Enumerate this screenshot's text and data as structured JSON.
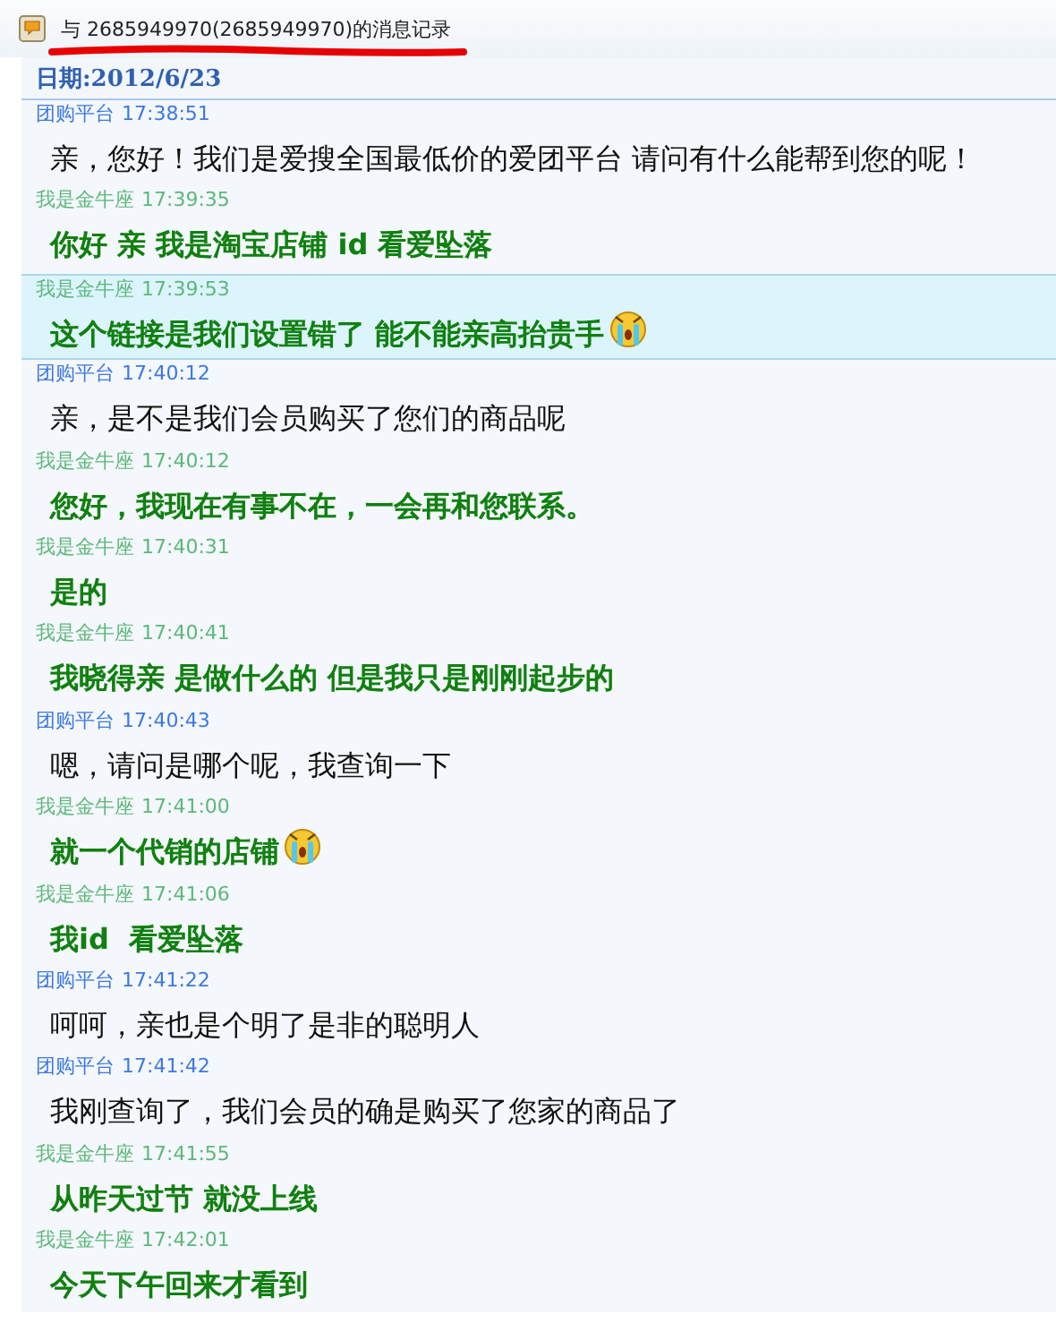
{
  "window": {
    "title": "与 2685949970(2685949970)的消息记录"
  },
  "date_label": "日期:2012/6/23",
  "messages": [
    {
      "kind": "service",
      "sender": "团购平台",
      "time": "17:38:51",
      "text": "亲，您好！我们是爱搜全国最低价的爱团平台 请问有什么能帮到您的呢！",
      "selected": false,
      "emoji": false
    },
    {
      "kind": "self",
      "sender": "我是金牛座",
      "time": "17:39:35",
      "text": "你好 亲 我是淘宝店铺 id 看爱坠落",
      "selected": false,
      "emoji": false
    },
    {
      "kind": "self",
      "sender": "我是金牛座",
      "time": "17:39:53",
      "text": "这个链接是我们设置错了 能不能亲高抬贵手",
      "selected": true,
      "emoji": true
    },
    {
      "kind": "service",
      "sender": "团购平台",
      "time": "17:40:12",
      "text": "亲，是不是我们会员购买了您们的商品呢",
      "selected": false,
      "emoji": false
    },
    {
      "kind": "self",
      "sender": "我是金牛座",
      "time": "17:40:12",
      "text": "您好，我现在有事不在，一会再和您联系。",
      "selected": false,
      "emoji": false
    },
    {
      "kind": "self",
      "sender": "我是金牛座",
      "time": "17:40:31",
      "text": "是的",
      "selected": false,
      "emoji": false
    },
    {
      "kind": "self",
      "sender": "我是金牛座",
      "time": "17:40:41",
      "text": "我晓得亲 是做什么的 但是我只是刚刚起步的",
      "selected": false,
      "emoji": false
    },
    {
      "kind": "service",
      "sender": "团购平台",
      "time": "17:40:43",
      "text": "嗯，请问是哪个呢，我查询一下",
      "selected": false,
      "emoji": false
    },
    {
      "kind": "self",
      "sender": "我是金牛座",
      "time": "17:41:00",
      "text": "就一个代销的店铺",
      "selected": false,
      "emoji": true
    },
    {
      "kind": "self",
      "sender": "我是金牛座",
      "time": "17:41:06",
      "text": "我id  看爱坠落",
      "selected": false,
      "emoji": false
    },
    {
      "kind": "service",
      "sender": "团购平台",
      "time": "17:41:22",
      "text": "呵呵，亲也是个明了是非的聪明人",
      "selected": false,
      "emoji": false
    },
    {
      "kind": "service",
      "sender": "团购平台",
      "time": "17:41:42",
      "text": "我刚查询了，我们会员的确是购买了您家的商品了",
      "selected": false,
      "emoji": false
    },
    {
      "kind": "self",
      "sender": "我是金牛座",
      "time": "17:41:55",
      "text": "从昨天过节 就没上线",
      "selected": false,
      "emoji": false
    },
    {
      "kind": "self",
      "sender": "我是金牛座",
      "time": "17:42:01",
      "text": "今天下午回来才看到",
      "selected": false,
      "emoji": false
    }
  ]
}
